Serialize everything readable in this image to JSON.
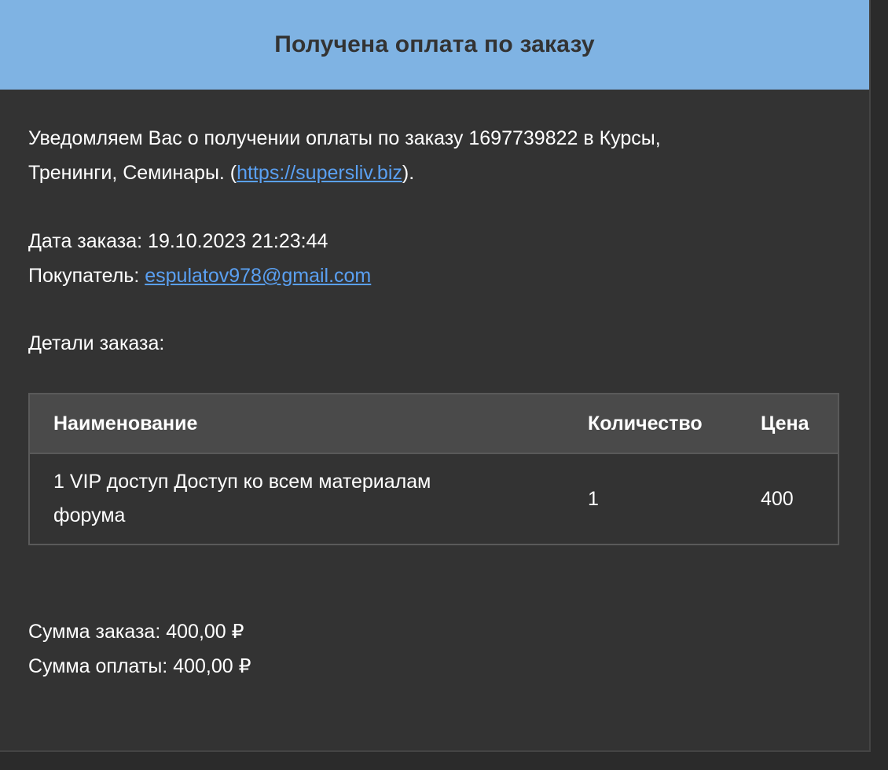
{
  "header": {
    "title": "Получена оплата по заказу"
  },
  "intro": {
    "text_before": "Уведомляем Вас о получении оплаты по заказу 1697739822 в Курсы,",
    "text_line2_prefix": "Тренинги, Семинары. (",
    "link": "https://supersliv.biz",
    "text_after": ")."
  },
  "order_info": {
    "date_label": "Дата заказа: ",
    "date_value": "19.10.2023 21:23:44",
    "buyer_label": "Покупатель: ",
    "buyer_email": "espulatov978@gmail.com"
  },
  "details_label": "Детали заказа:",
  "table": {
    "headers": [
      "Наименование",
      "Количество",
      "Цена"
    ],
    "rows": [
      {
        "name_line1": "1 VIP доступ Доступ ко всем материалам",
        "name_line2": "форума",
        "quantity": "1",
        "price": "400"
      }
    ]
  },
  "totals": {
    "order_sum": "Сумма заказа: 400,00 ₽",
    "payment_sum": "Сумма оплаты: 400,00 ₽"
  },
  "colors": {
    "header_bg": "#7fb3e3",
    "body_bg": "#333333",
    "link": "#5aa0f2",
    "table_header_bg": "#4a4a4a"
  }
}
